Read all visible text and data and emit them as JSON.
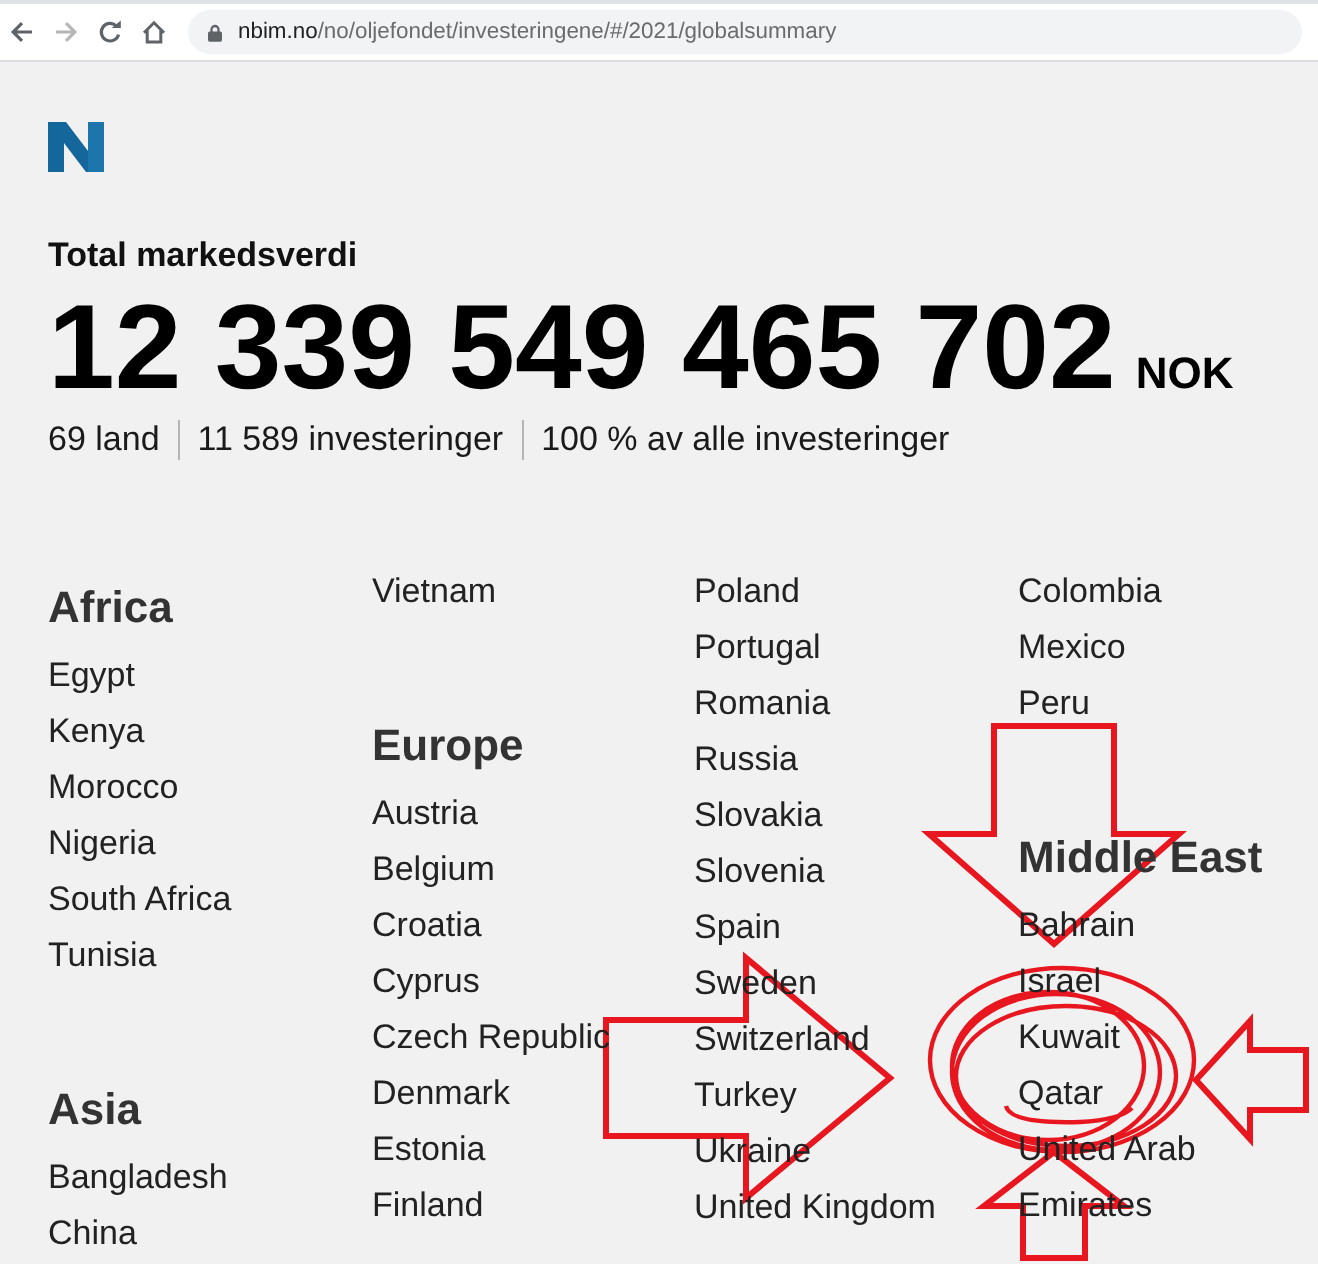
{
  "browser": {
    "nav_buttons": [
      {
        "kind": "back",
        "disabled": false
      },
      {
        "kind": "forward",
        "disabled": true
      },
      {
        "kind": "reload",
        "disabled": false
      },
      {
        "kind": "home",
        "disabled": false
      }
    ],
    "url_host": "nbim.no",
    "url_path": "/no/oljefondet/investeringene/#/2021/globalsummary"
  },
  "summary": {
    "title": "Total markedsverdi",
    "value": "12 339 549 465 702",
    "currency": "NOK",
    "stats": [
      "69 land",
      "11 589 investeringer",
      "100 % av alle investeringer"
    ]
  },
  "country_columns": [
    [
      {
        "kind": "region",
        "text": "Africa"
      },
      {
        "kind": "country",
        "text": "Egypt"
      },
      {
        "kind": "country",
        "text": "Kenya"
      },
      {
        "kind": "country",
        "text": "Morocco"
      },
      {
        "kind": "country",
        "text": "Nigeria"
      },
      {
        "kind": "country",
        "text": "South Africa"
      },
      {
        "kind": "country",
        "text": "Tunisia"
      },
      {
        "kind": "region",
        "text": "Asia"
      },
      {
        "kind": "country",
        "text": "Bangladesh"
      },
      {
        "kind": "country",
        "text": "China"
      }
    ],
    [
      {
        "kind": "country",
        "text": "Vietnam"
      },
      {
        "kind": "region",
        "text": "Europe"
      },
      {
        "kind": "country",
        "text": "Austria"
      },
      {
        "kind": "country",
        "text": "Belgium"
      },
      {
        "kind": "country",
        "text": "Croatia"
      },
      {
        "kind": "country",
        "text": "Cyprus"
      },
      {
        "kind": "country",
        "text": "Czech Republic"
      },
      {
        "kind": "country",
        "text": "Denmark"
      },
      {
        "kind": "country",
        "text": "Estonia"
      },
      {
        "kind": "country",
        "text": "Finland"
      }
    ],
    [
      {
        "kind": "country",
        "text": "Poland"
      },
      {
        "kind": "country",
        "text": "Portugal"
      },
      {
        "kind": "country",
        "text": "Romania"
      },
      {
        "kind": "country",
        "text": "Russia"
      },
      {
        "kind": "country",
        "text": "Slovakia"
      },
      {
        "kind": "country",
        "text": "Slovenia"
      },
      {
        "kind": "country",
        "text": "Spain"
      },
      {
        "kind": "country",
        "text": "Sweden"
      },
      {
        "kind": "country",
        "text": "Switzerland"
      },
      {
        "kind": "country",
        "text": "Turkey"
      },
      {
        "kind": "country",
        "text": "Ukraine"
      },
      {
        "kind": "country",
        "text": "United Kingdom"
      }
    ],
    [
      {
        "kind": "country",
        "text": "Colombia"
      },
      {
        "kind": "country",
        "text": "Mexico"
      },
      {
        "kind": "country",
        "text": "Peru"
      },
      {
        "kind": "region",
        "text": "Middle East"
      },
      {
        "kind": "country",
        "text": "Bahrain"
      },
      {
        "kind": "country",
        "text": "Israel"
      },
      {
        "kind": "country",
        "text": "Kuwait"
      },
      {
        "kind": "country",
        "text": "Qatar"
      },
      {
        "kind": "country",
        "text": "United Arab Emirates"
      }
    ]
  ],
  "annotations": [
    {
      "kind": "arrow_down"
    },
    {
      "kind": "arrow_right"
    },
    {
      "kind": "circle"
    },
    {
      "kind": "arrow_left"
    },
    {
      "kind": "arrow_up"
    }
  ]
}
